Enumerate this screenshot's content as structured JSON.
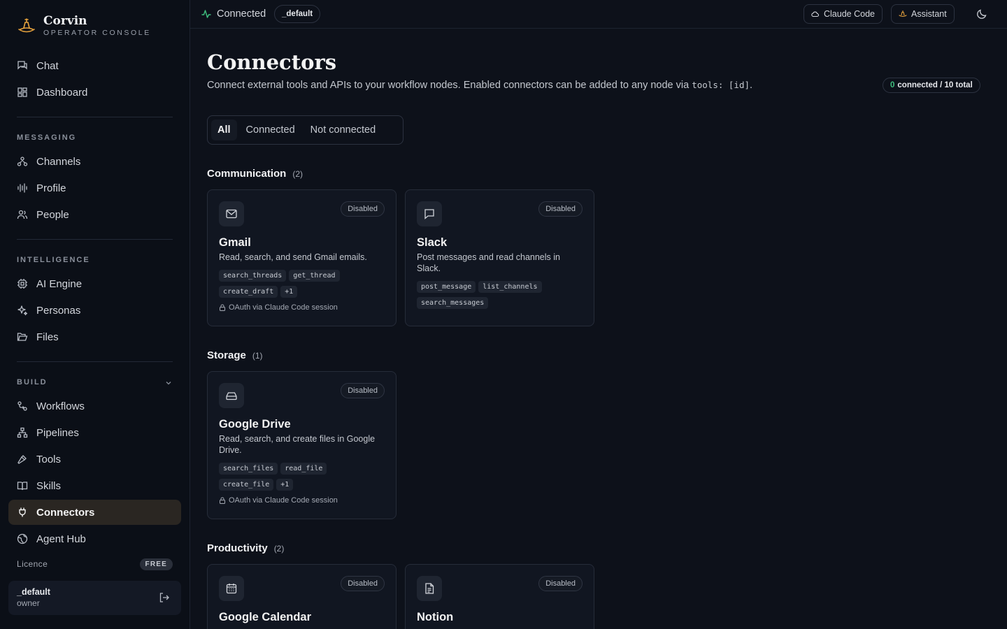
{
  "brand": {
    "name": "Corvin",
    "subtitle": "OPERATOR CONSOLE"
  },
  "nav": {
    "top": [
      {
        "label": "Chat",
        "icon": "chat-icon"
      },
      {
        "label": "Dashboard",
        "icon": "dashboard-icon"
      }
    ],
    "messaging_label": "MESSAGING",
    "messaging": [
      {
        "label": "Channels",
        "icon": "channels-icon"
      },
      {
        "label": "Profile",
        "icon": "waveform-icon"
      },
      {
        "label": "People",
        "icon": "people-icon"
      }
    ],
    "intelligence_label": "INTELLIGENCE",
    "intelligence": [
      {
        "label": "AI Engine",
        "icon": "cpu-icon"
      },
      {
        "label": "Personas",
        "icon": "sparkles-icon"
      },
      {
        "label": "Files",
        "icon": "folder-icon"
      }
    ],
    "build_label": "BUILD",
    "build": [
      {
        "label": "Workflows",
        "icon": "workflow-icon"
      },
      {
        "label": "Pipelines",
        "icon": "pipeline-icon"
      },
      {
        "label": "Tools",
        "icon": "hammer-icon"
      },
      {
        "label": "Skills",
        "icon": "book-icon"
      },
      {
        "label": "Connectors",
        "icon": "plug-icon",
        "active": true
      },
      {
        "label": "Agent Hub",
        "icon": "globe-icon"
      }
    ]
  },
  "licence": {
    "label": "Licence",
    "tier": "FREE"
  },
  "user": {
    "name": "_default",
    "role": "owner"
  },
  "topbar": {
    "status": "Connected",
    "workspace": "_default",
    "claude_code": "Claude Code",
    "assistant": "Assistant"
  },
  "page": {
    "title": "Connectors",
    "description": "Connect external tools and APIs to your workflow nodes. Enabled connectors can be added to any node via ",
    "code": "tools: [id]",
    "description_end": ".",
    "count_connected": "0",
    "count_rest": "connected / 10 total"
  },
  "filters": [
    "All",
    "Connected",
    "Not connected"
  ],
  "categories": [
    {
      "title": "Communication",
      "count": "(2)",
      "connectors": [
        {
          "name": "Gmail",
          "status": "Disabled",
          "description": "Read, search, and send Gmail emails.",
          "tags": [
            "search_threads",
            "get_thread",
            "create_draft",
            "+1"
          ],
          "auth": "OAuth via Claude Code session"
        },
        {
          "name": "Slack",
          "status": "Disabled",
          "description": "Post messages and read channels in Slack.",
          "tags": [
            "post_message",
            "list_channels",
            "search_messages"
          ],
          "auth": ""
        }
      ]
    },
    {
      "title": "Storage",
      "count": "(1)",
      "connectors": [
        {
          "name": "Google Drive",
          "status": "Disabled",
          "description": "Read, search, and create files in Google Drive.",
          "tags": [
            "search_files",
            "read_file",
            "create_file",
            "+1"
          ],
          "auth": "OAuth via Claude Code session"
        }
      ]
    },
    {
      "title": "Productivity",
      "count": "(2)",
      "connectors": [
        {
          "name": "Google Calendar",
          "status": "Disabled",
          "description": "",
          "tags": [],
          "auth": ""
        },
        {
          "name": "Notion",
          "status": "Disabled",
          "description": "",
          "tags": [],
          "auth": ""
        }
      ]
    }
  ]
}
